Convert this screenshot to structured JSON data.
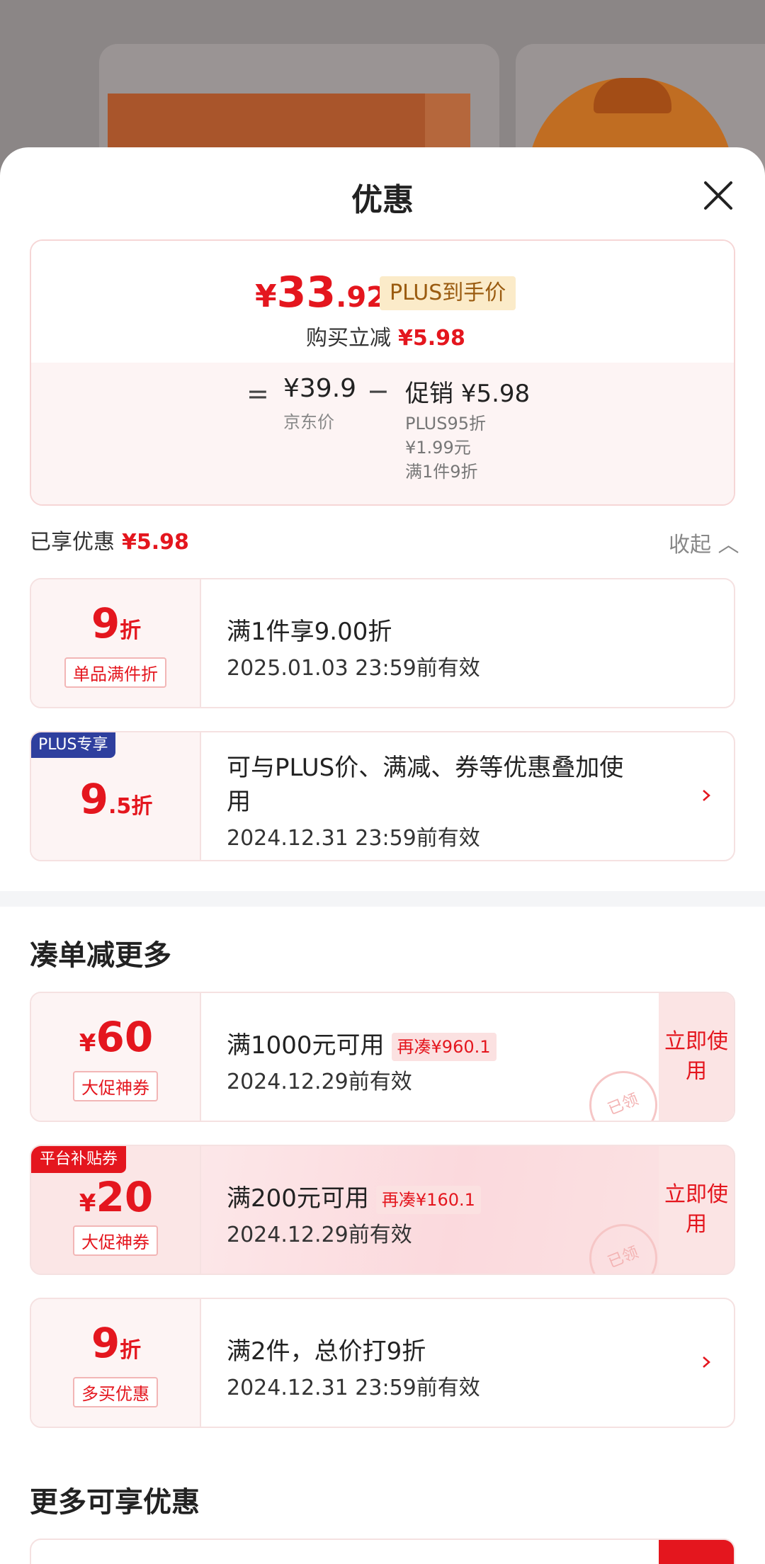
{
  "sheet": {
    "title": "优惠"
  },
  "price_box": {
    "final_price": {
      "yen": "¥",
      "int": "33",
      "dec": ".92"
    },
    "plus_tag": "PLUS到手价",
    "buy_reduce_label": "购买立减",
    "buy_reduce_amount": "¥5.98",
    "equals": "=",
    "jd_price": "¥39.9",
    "jd_label": "京东价",
    "minus": "−",
    "promo_line": "促销 ¥5.98",
    "promo_details": [
      "PLUS95折",
      "¥1.99元",
      "满1件9折"
    ]
  },
  "summary": {
    "enjoyed_label": "已享优惠",
    "enjoyed_amount": "¥5.98",
    "collapse": "收起 ︿"
  },
  "enjoyed_cards": [
    {
      "num": "9",
      "unit": "折",
      "tag": "单品满件折",
      "title": "满1件享9.00折",
      "validity": "2025.01.03 23:59前有效"
    },
    {
      "badge": "PLUS专享",
      "num": "9",
      "num_dec": ".5",
      "unit": "折",
      "title_line1": "可与PLUS价、满减、券等优惠叠加使",
      "title_line2": "用",
      "validity": "2024.12.31 23:59前有效"
    }
  ],
  "section_more": "凑单减更多",
  "more_cards": [
    {
      "yen": "¥",
      "num": "60",
      "tag": "大促神券",
      "title": "满1000元可用",
      "extra_tag": "再凑¥960.1",
      "validity": "2024.12.29前有效",
      "action": "立即使用",
      "stamp": "已领"
    },
    {
      "badge": "平台补贴券",
      "yen": "¥",
      "num": "20",
      "tag": "大促神券",
      "title": "满200元可用",
      "extra_tag": "再凑¥160.1",
      "validity": "2024.12.29前有效",
      "action": "立即使用",
      "stamp": "已领"
    },
    {
      "num": "9",
      "unit": "折",
      "tag": "多买优惠",
      "title": "满2件，总价打9折",
      "validity": "2024.12.31 23:59前有效"
    }
  ],
  "section_more_benefits": "更多可享优惠",
  "colors": {
    "accent": "#e4161e",
    "plus_badge": "#2f3f9e",
    "plus_tag_bg": "#fbebc9"
  },
  "icons": {
    "close": "close-icon",
    "chevron": "chevron-right-icon",
    "collapse": "chevron-up-icon"
  }
}
